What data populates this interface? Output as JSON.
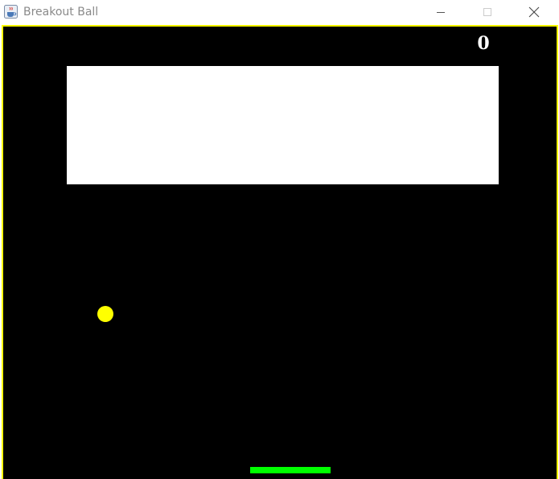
{
  "window": {
    "title": "Breakout Ball",
    "icons": {
      "app": "java-cup-icon",
      "minimize": "minimize-icon",
      "maximize": "maximize-icon",
      "close": "close-icon"
    }
  },
  "game": {
    "score": "0",
    "colors": {
      "background": "#000000",
      "border": "#ffff00",
      "bricks": "#ffffff",
      "ball": "#ffff00",
      "paddle": "#00ff00",
      "score": "#ffffff"
    }
  }
}
